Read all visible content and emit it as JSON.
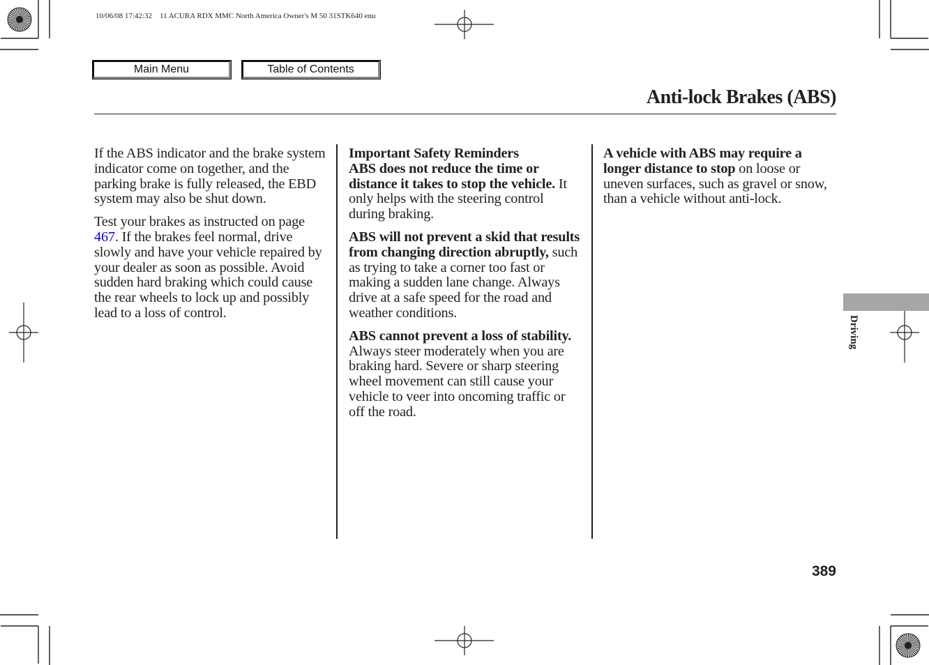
{
  "print_info": "10/06/08 17:42:32    11 ACURA RDX MMC North America Owner's M 50 31STK640 enu",
  "nav": {
    "main_menu_label": "Main Menu",
    "toc_label": "Table of Contents"
  },
  "header": {
    "title": "Anti-lock Brakes (ABS)"
  },
  "columns": {
    "col1": {
      "p1": "If the ABS indicator and the brake system indicator come on together, and the parking brake is fully released, the EBD system may also be shut down.",
      "p2_before": "Test your brakes as instructed on page ",
      "p2_link": "467",
      "p2_after": ". If the brakes feel normal, drive slowly and have your vehicle repaired by your dealer as soon as possible. Avoid sudden hard braking which could cause the rear wheels to lock up and possibly lead to a loss of control."
    },
    "col2": {
      "heading": "Important Safety Reminders",
      "p1_bold": "ABS does not reduce the time or distance it takes to stop the vehicle.",
      "p1_rest": " It only helps with the steering control during braking.",
      "p2_bold": "ABS will not prevent a skid that results from changing direction abruptly,",
      "p2_rest": " such as trying to take a corner too fast or making a sudden lane change. Always drive at a safe speed for the road and weather conditions.",
      "p3_bold": "ABS cannot prevent a loss of stability.",
      "p3_rest": " Always steer moderately when you are braking hard. Severe or sharp steering wheel movement can still cause your vehicle to veer into oncoming traffic or off the road."
    },
    "col3": {
      "p1_bold": "A vehicle with ABS may require a longer distance to stop",
      "p1_rest": " on loose or uneven surfaces, such as gravel or snow, than a vehicle without anti-lock."
    }
  },
  "side_tab": {
    "label": "Driving",
    "color": "#a7a5a6"
  },
  "footer": {
    "page_number": "389"
  },
  "colors": {
    "text": "#231f20",
    "link": "#0000ee"
  }
}
